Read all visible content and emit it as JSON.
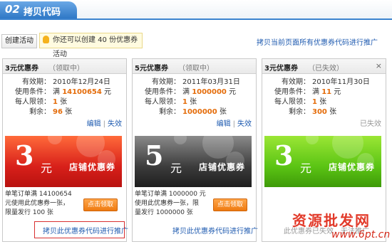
{
  "header": {
    "number": "02",
    "title": "拷贝代码"
  },
  "toolbar": {
    "create_label": "创建活动",
    "tip": "你还可以创建 40 份优惠券活动",
    "promote_all": "拷贝当前页面所有优惠券代码进行推广"
  },
  "cards": [
    {
      "name": "3元优惠券",
      "status": "（领取中）",
      "labels": {
        "valid": "有效期：",
        "condition": "使用条件：",
        "limit": "每人限领：",
        "remain": "剩余："
      },
      "valid": "2010年12月24日",
      "cond_prefix": "满",
      "cond_value": "14100654",
      "cond_unit": "元",
      "limit_value": "1",
      "limit_unit": "张",
      "remain_value": "96",
      "remain_unit": "张",
      "edit": "编辑",
      "disable": "失效",
      "ticket": {
        "amount": "3",
        "yuan": "元",
        "shop": "店铺优惠券"
      },
      "desc": [
        "单笔订单满 14100654",
        "元使用此优惠券一张，",
        "限量发行 100 张"
      ],
      "get_label": "点击领取",
      "promote": "拷贝此优惠券代码进行推广"
    },
    {
      "name": "5元优惠券",
      "status": "（领取中）",
      "labels": {
        "valid": "有效期：",
        "condition": "使用条件：",
        "limit": "每人限领：",
        "remain": "剩余："
      },
      "valid": "2011年03月31日",
      "cond_prefix": "满",
      "cond_value": "1000000",
      "cond_unit": "元",
      "limit_value": "1",
      "limit_unit": "张",
      "remain_value": "1000000",
      "remain_unit": "张",
      "edit": "编辑",
      "disable": "失效",
      "ticket": {
        "amount": "5",
        "yuan": "元",
        "shop": "店铺优惠券"
      },
      "desc": [
        "单笔订单满 1000000 元",
        "使用此优惠券一张，限",
        "量发行 1000000 张"
      ],
      "get_label": "点击领取",
      "promote": "拷贝此优惠券代码进行推广"
    },
    {
      "name": "3元优惠券",
      "status": "（已失效）",
      "labels": {
        "valid": "有效期：",
        "condition": "使用条件：",
        "limit": "每人限领：",
        "remain": "剩余："
      },
      "valid": "2010年11月30日",
      "cond_prefix": "满",
      "cond_value": "11",
      "cond_unit": "元",
      "limit_value": "1",
      "limit_unit": "张",
      "remain_value": "300",
      "remain_unit": "张",
      "expired": "已失效",
      "ticket": {
        "amount": "3",
        "yuan": "元",
        "shop": "店铺优惠券"
      },
      "promote": "此优惠券已失效，无法推广",
      "close": "×"
    }
  ],
  "watermark": {
    "text": "资源批发网",
    "url": "www.6pt.cn"
  },
  "colors": {
    "accent_blue": "#2f78c6",
    "orange": "#e46c0a",
    "link": "#1f5bb0",
    "red_ticket": "#d8201a",
    "green_ticket": "#5bc414",
    "gray_ticket": "#3c3c3c"
  }
}
